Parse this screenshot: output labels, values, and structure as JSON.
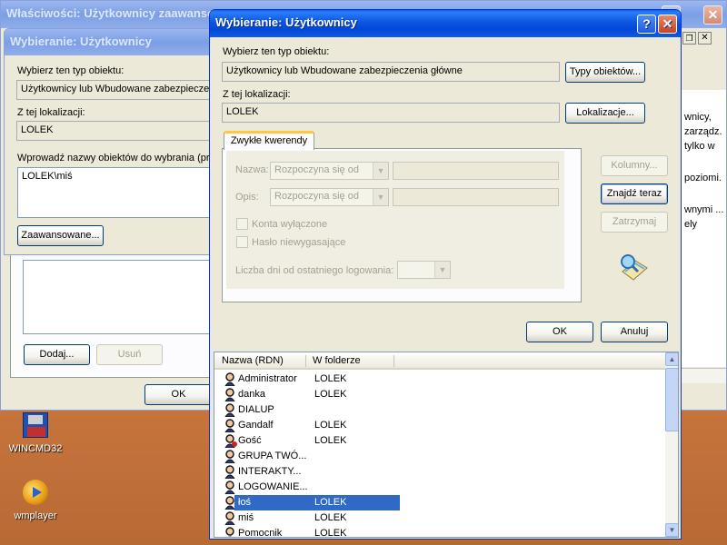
{
  "colors": {
    "xp_blue": "#0a5fe9",
    "dialog_bg": "#ece9d8",
    "selection": "#316ac5"
  },
  "bg_window": {
    "title": "Właściwości: Użytkownicy zaawanso",
    "right_panel_texts": [
      "wnicy,",
      "zarządz.",
      "tylko w",
      "poziomi.",
      "wnymi ...",
      "ely"
    ],
    "buttons": {
      "add": "Dodaj...",
      "remove": "Usuń",
      "ok": "OK"
    }
  },
  "mid_window": {
    "title": "Wybieranie: Użytkownicy",
    "type_label": "Wybierz ten typ obiektu:",
    "type_value": "Użytkownicy lub Wbudowane zabezpieczen",
    "location_label": "Z tej lokalizacji:",
    "location_value": "LOLEK",
    "names_label": "Wprowadź nazwy obiektów do wybrania (prz",
    "names_value": "LOLEK\\miś",
    "advanced_button": "Zaawansowane..."
  },
  "dialog": {
    "title": "Wybieranie: Użytkownicy",
    "help_glyph": "?",
    "close_glyph": "✕",
    "type_label": "Wybierz ten typ obiektu:",
    "type_value": "Użytkownicy lub Wbudowane zabezpieczenia główne",
    "types_button": "Typy obiektów...",
    "location_label": "Z tej lokalizacji:",
    "location_value": "LOLEK",
    "locations_button": "Lokalizacje...",
    "tab": "Zwykłe kwerendy",
    "name_label": "Nazwa:",
    "name_combo": "Rozpoczyna się od",
    "desc_label": "Opis:",
    "desc_combo": "Rozpoczyna się od",
    "disabled_accounts": "Konta wyłączone",
    "non_expiring_pwd": "Hasło niewygasające",
    "days_label": "Liczba dni od ostatniego logowania:",
    "columns_button": "Kolumny...",
    "find_now_button": "Znajdź teraz",
    "stop_button": "Zatrzymaj",
    "ok_button": "OK",
    "cancel_button": "Anuluj",
    "col_name": "Nazwa (RDN)",
    "col_folder": "W folderze",
    "rows": [
      {
        "name": "Administrator",
        "folder": "LOLEK"
      },
      {
        "name": "danka",
        "folder": "LOLEK"
      },
      {
        "name": "DIALUP",
        "folder": ""
      },
      {
        "name": "Gandalf",
        "folder": "LOLEK"
      },
      {
        "name": "Gość",
        "folder": "LOLEK"
      },
      {
        "name": "GRUPA TWÓ...",
        "folder": ""
      },
      {
        "name": "INTERAKTY...",
        "folder": ""
      },
      {
        "name": "LOGOWANIE...",
        "folder": ""
      },
      {
        "name": "łoś",
        "folder": "LOLEK"
      },
      {
        "name": "miś",
        "folder": "LOLEK"
      },
      {
        "name": "Pomocnik",
        "folder": "LOLEK"
      }
    ],
    "selected_row": 8
  },
  "desktop": {
    "icon1": "WINCMD32",
    "icon2": "wmplayer"
  }
}
